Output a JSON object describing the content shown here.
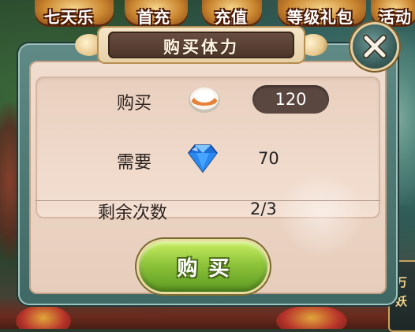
{
  "topbar": {
    "tabs": [
      "七天乐",
      "首充",
      "充值",
      "等级礼包",
      "活动"
    ]
  },
  "dialog": {
    "title": "购买体力",
    "rows": {
      "buy_label": "购买",
      "buy_icon": "steamed-bun-icon",
      "buy_quantity": "120",
      "cost_label": "需要",
      "cost_icon": "blue-diamond-icon",
      "cost_value": "70",
      "remaining_label": "剩余次数",
      "remaining_value": "2/3"
    },
    "buy_button_label": "购买",
    "close_icon": "close-x-icon"
  },
  "side_badge": {
    "text": "万妖"
  },
  "colors": {
    "dialog_frame": "#5f8a86",
    "dialog_body": "#f1ddd0",
    "title_plate": "#5a3f33",
    "buy_button": "#8ec43a",
    "quantity_pill": "#5a4740"
  }
}
